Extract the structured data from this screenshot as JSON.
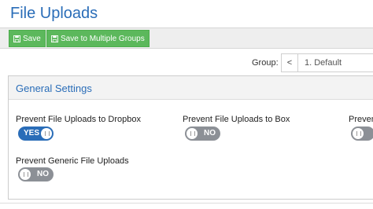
{
  "page": {
    "title": "File Uploads"
  },
  "toolbar": {
    "save_label": "Save",
    "save_multi_label": "Save to Multiple Groups"
  },
  "group": {
    "label": "Group:",
    "prev_glyph": "<",
    "selected": "1. Default"
  },
  "panel": {
    "title": "General Settings",
    "settings": [
      {
        "label": "Prevent File Uploads to Dropbox",
        "state": "YES"
      },
      {
        "label": "Prevent File Uploads to Box",
        "state": "NO"
      },
      {
        "label": "Prevent",
        "state": ""
      },
      {
        "label": "Prevent Generic File Uploads",
        "state": "NO"
      }
    ]
  },
  "colors": {
    "accent": "#2a6db8",
    "button_green": "#5cb85c",
    "toggle_off": "#8c9096"
  },
  "icons": {
    "save": "floppy-disk-icon"
  }
}
